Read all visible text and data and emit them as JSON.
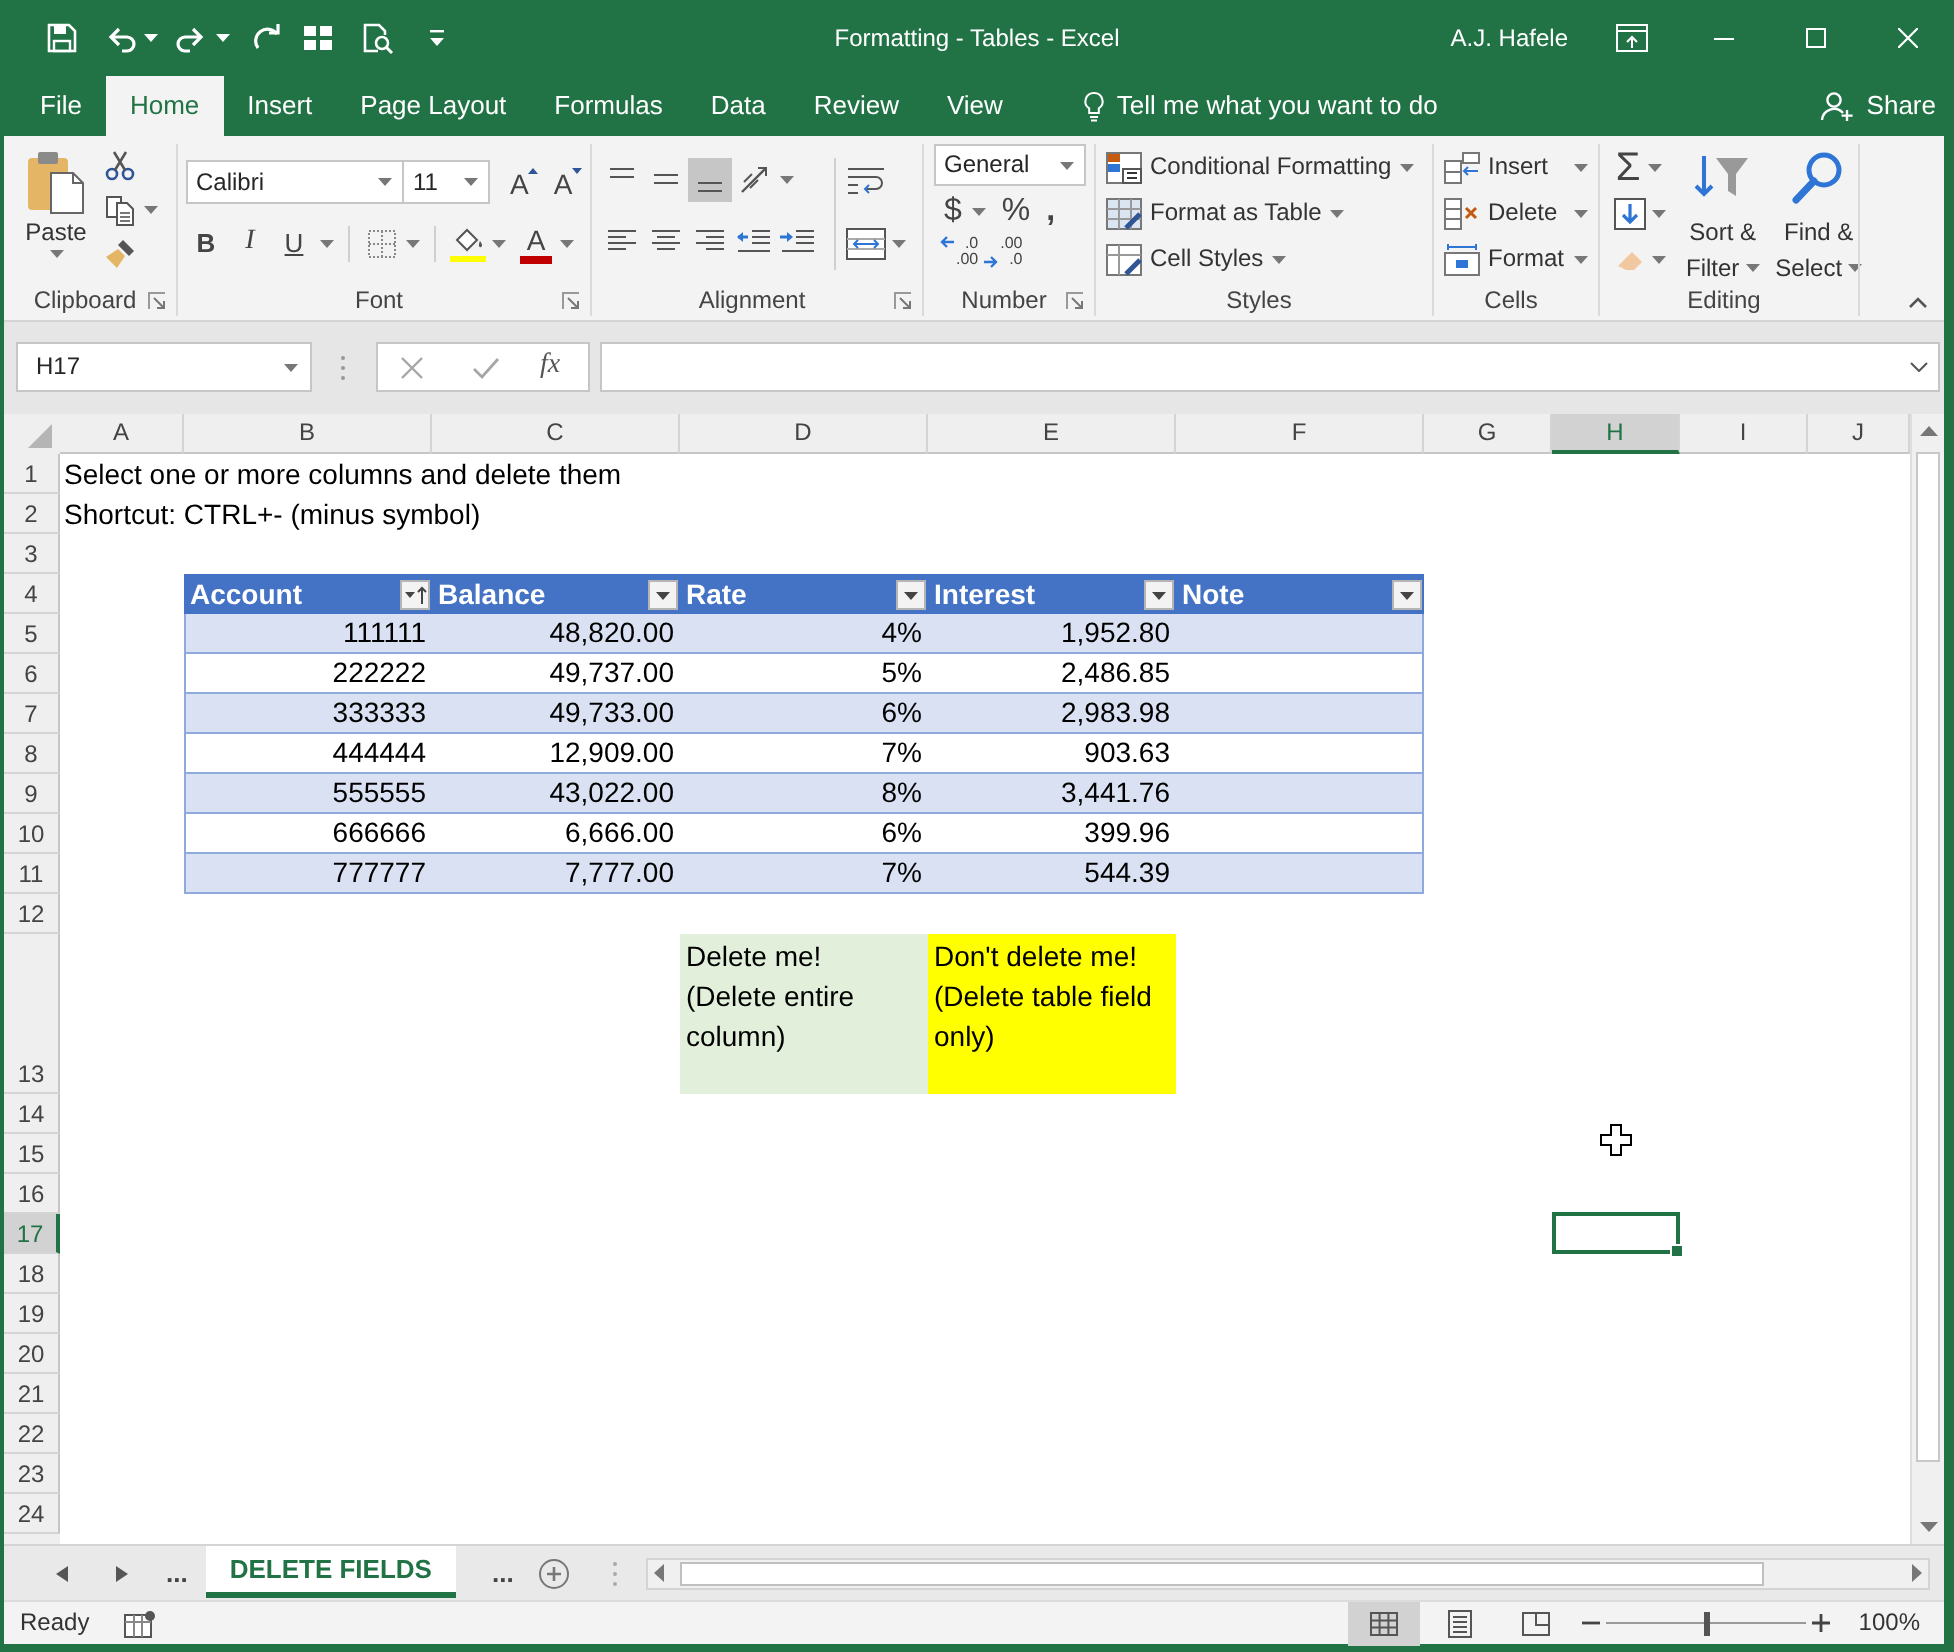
{
  "window": {
    "title": "Formatting - Tables - Excel",
    "user": "A.J. Hafele"
  },
  "ribbon_tabs": [
    {
      "label": "File",
      "selected": false
    },
    {
      "label": "Home",
      "selected": true
    },
    {
      "label": "Insert",
      "selected": false
    },
    {
      "label": "Page Layout",
      "selected": false
    },
    {
      "label": "Formulas",
      "selected": false
    },
    {
      "label": "Data",
      "selected": false
    },
    {
      "label": "Review",
      "selected": false
    },
    {
      "label": "View",
      "selected": false
    }
  ],
  "tell_me": {
    "placeholder": "Tell me what you want to do"
  },
  "share": "Share",
  "ribbon": {
    "clipboard": {
      "label": "Clipboard",
      "paste": "Paste"
    },
    "font": {
      "label": "Font",
      "font_name": "Calibri",
      "font_size": "11",
      "grow": "A",
      "shrink": "A",
      "bold": "B",
      "italic": "I",
      "underline": "U",
      "font_color": "A"
    },
    "alignment": {
      "label": "Alignment",
      "vertical_align_buttons": [
        {
          "kind": "top",
          "selected": false
        },
        {
          "kind": "middle",
          "selected": false
        },
        {
          "kind": "bottom",
          "selected": true
        }
      ]
    },
    "number": {
      "label": "Number",
      "format": "General",
      "currency": "$",
      "percent": "%",
      "comma": ",",
      "decimals": [
        {
          "kind": "increase",
          "top": ".0",
          "bottom": ".00"
        },
        {
          "kind": "decrease",
          "top": ".00",
          "bottom": ".0"
        }
      ]
    },
    "styles": {
      "label": "Styles",
      "buttons": [
        "Conditional Formatting",
        "Format as Table",
        "Cell Styles"
      ]
    },
    "cells": {
      "label": "Cells",
      "buttons": [
        "Insert",
        "Delete",
        "Format"
      ]
    },
    "editing": {
      "label": "Editing",
      "autosum": "Σ",
      "buttons": [
        {
          "line1": "Sort &",
          "line2": "Filter"
        },
        {
          "line1": "Find &",
          "line2": "Select"
        }
      ]
    }
  },
  "formula_bar": {
    "name_box": "H17",
    "function": "fx"
  },
  "sheet": {
    "columns": [
      {
        "label": "A",
        "selected": false
      },
      {
        "label": "B",
        "selected": false
      },
      {
        "label": "C",
        "selected": false
      },
      {
        "label": "D",
        "selected": false
      },
      {
        "label": "E",
        "selected": false
      },
      {
        "label": "F",
        "selected": false
      },
      {
        "label": "G",
        "selected": false
      },
      {
        "label": "H",
        "selected": true
      },
      {
        "label": "I",
        "selected": false
      },
      {
        "label": "J",
        "selected": false
      }
    ],
    "rows": [
      {
        "label": "1",
        "selected": false
      },
      {
        "label": "2",
        "selected": false
      },
      {
        "label": "3",
        "selected": false
      },
      {
        "label": "4",
        "selected": false
      },
      {
        "label": "5",
        "selected": false
      },
      {
        "label": "6",
        "selected": false
      },
      {
        "label": "7",
        "selected": false
      },
      {
        "label": "8",
        "selected": false
      },
      {
        "label": "9",
        "selected": false
      },
      {
        "label": "10",
        "selected": false
      },
      {
        "label": "11",
        "selected": false
      },
      {
        "label": "12",
        "selected": false
      },
      {
        "label": "13",
        "selected": false
      },
      {
        "label": "14",
        "selected": false
      },
      {
        "label": "15",
        "selected": false
      },
      {
        "label": "16",
        "selected": false
      },
      {
        "label": "17",
        "selected": true
      },
      {
        "label": "18",
        "selected": false
      },
      {
        "label": "19",
        "selected": false
      },
      {
        "label": "20",
        "selected": false
      },
      {
        "label": "21",
        "selected": false
      },
      {
        "label": "22",
        "selected": false
      },
      {
        "label": "23",
        "selected": false
      },
      {
        "label": "24",
        "selected": false
      }
    ],
    "instructions": [
      "Select one or more columns and delete them",
      "Shortcut: CTRL+- (minus symbol)"
    ],
    "table": {
      "columns": [
        {
          "label": "Account",
          "sorted": true
        },
        {
          "label": "Balance",
          "sorted": false
        },
        {
          "label": "Rate",
          "sorted": false
        },
        {
          "label": "Interest",
          "sorted": false
        },
        {
          "label": "Note",
          "sorted": false
        }
      ],
      "rows": [
        [
          "111111",
          "48,820.00",
          "4%",
          "1,952.80"
        ],
        [
          "222222",
          "49,737.00",
          "5%",
          "2,486.85"
        ],
        [
          "333333",
          "49,733.00",
          "6%",
          "2,983.98"
        ],
        [
          "444444",
          "12,909.00",
          "7%",
          "903.63"
        ],
        [
          "555555",
          "43,022.00",
          "8%",
          "3,441.76"
        ],
        [
          "666666",
          "6,666.00",
          "6%",
          "399.96"
        ],
        [
          "777777",
          "7,777.00",
          "7%",
          "544.39"
        ]
      ]
    },
    "notes": [
      {
        "lines": [
          "Delete me!",
          "(Delete entire column)"
        ],
        "color": "#e2efda"
      },
      {
        "lines": [
          "Don't delete me!",
          "(Delete table field only)"
        ],
        "color": "#ffff00"
      }
    ]
  },
  "sheet_tab_bar": {
    "more_before": "...",
    "more_after": "..."
  },
  "sheet_tabs": [
    {
      "label": "DELETE FIELDS",
      "selected": true
    }
  ],
  "status_bar": {
    "status": "Ready",
    "views": [
      {
        "kind": "normal",
        "selected": true
      },
      {
        "kind": "page_layout",
        "selected": false
      },
      {
        "kind": "page_break",
        "selected": false
      }
    ],
    "zoom": {
      "level": 0.5,
      "reading": "100%"
    }
  }
}
